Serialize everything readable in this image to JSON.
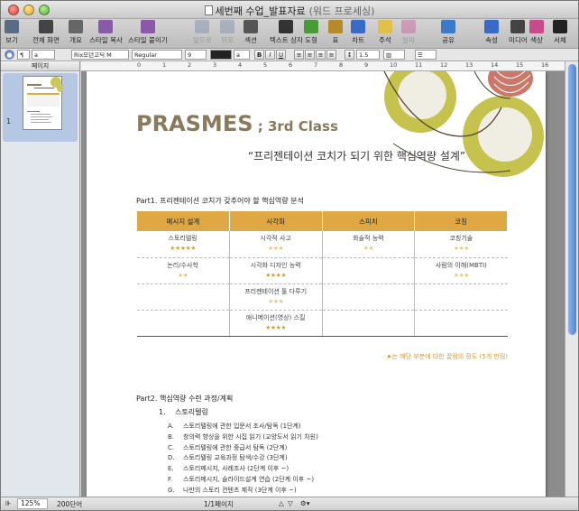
{
  "window": {
    "title": "세번째 수업_발표자료",
    "mode": "(워드 프로세싱)"
  },
  "toolbar": {
    "items": [
      {
        "label": "보기",
        "icon": "view-icon",
        "color": "#5a6b85",
        "enabled": true
      },
      {
        "label": "전체 화면",
        "icon": "fullscreen-icon",
        "color": "#444444",
        "enabled": true
      },
      {
        "label": "개요",
        "icon": "outline-icon",
        "color": "#666666",
        "enabled": true
      },
      {
        "label": "스타일 복사",
        "icon": "copy-style-icon",
        "color": "#8a5aa8",
        "enabled": true
      },
      {
        "label": "스타일 붙이기",
        "icon": "paste-style-icon",
        "color": "#8a5aa8",
        "enabled": true
      },
      {
        "label": "앞으로",
        "icon": "bring-forward-icon",
        "color": "#7c8ca8",
        "enabled": false
      },
      {
        "label": "뒤로",
        "icon": "send-backward-icon",
        "color": "#7c8ca8",
        "enabled": false
      },
      {
        "label": "섹션",
        "icon": "section-icon",
        "color": "#555555",
        "enabled": true
      },
      {
        "label": "텍스트 상자",
        "icon": "textbox-icon",
        "color": "#333333",
        "enabled": true
      },
      {
        "label": "도형",
        "icon": "shapes-icon",
        "color": "#4a9a3a",
        "enabled": true
      },
      {
        "label": "표",
        "icon": "table-icon",
        "color": "#b58a2a",
        "enabled": true
      },
      {
        "label": "차트",
        "icon": "chart-icon",
        "color": "#3a6ac8",
        "enabled": true
      },
      {
        "label": "주석",
        "icon": "comment-icon",
        "color": "#e0c04a",
        "enabled": true
      },
      {
        "label": "알파",
        "icon": "alpha-icon",
        "color": "#c85a9a",
        "enabled": false
      },
      {
        "label": "공유",
        "icon": "share-icon",
        "color": "#3a7ac8",
        "enabled": true
      },
      {
        "label": "속성",
        "icon": "inspector-icon",
        "color": "#3a6ac8",
        "enabled": true
      },
      {
        "label": "미디어",
        "icon": "media-icon",
        "color": "#444444",
        "enabled": true
      },
      {
        "label": "색상",
        "icon": "colors-icon",
        "color": "#c84a8a",
        "enabled": true
      },
      {
        "label": "서체",
        "icon": "fonts-icon",
        "color": "#222222",
        "enabled": true
      }
    ]
  },
  "format_bar": {
    "style_value": "a",
    "font_name": "Rix모던고딕 M",
    "font_style": "Regular",
    "font_size": "9",
    "char_style_value": "a",
    "bold": "B",
    "italic": "I",
    "underline": "U",
    "line_spacing": "1.5"
  },
  "sidebar": {
    "header": "페이지",
    "page_number": "1"
  },
  "ruler": {
    "numbers": [
      "0",
      "1",
      "2",
      "3",
      "4",
      "5",
      "6",
      "7",
      "8",
      "9",
      "10",
      "11",
      "12",
      "13",
      "14",
      "15",
      "16",
      "17"
    ]
  },
  "document": {
    "title_main": "PRASMES",
    "title_sep": " ; ",
    "title_sub": "3rd Class",
    "subtitle": "“프리젠테이션 코치가 되기 위한 핵심역량 설계”",
    "part1_heading": "Part1. 프리젠테이션 코치가 갖추어야 할 핵심역량 분석",
    "table": {
      "headers": [
        "메시지 설계",
        "시각화",
        "스피치",
        "코칭"
      ],
      "rows": [
        [
          {
            "text": "스토리텔링",
            "stars": "★★★★★",
            "light": false
          },
          {
            "text": "시각적 사고",
            "stars": "★★★",
            "light": true
          },
          {
            "text": "화술적 능력",
            "stars": "★★",
            "light": true
          },
          {
            "text": "코칭기술",
            "stars": "★★★",
            "light": true
          }
        ],
        [
          {
            "text": "논리/수사학",
            "stars": "★★",
            "light": true
          },
          {
            "text": "시각화 디자인 능력",
            "stars": "★★★★",
            "light": false
          },
          {
            "text": "",
            "stars": "",
            "light": false
          },
          {
            "text": "사람의 이해(MBTI)",
            "stars": "★★★",
            "light": true
          }
        ],
        [
          {
            "text": "",
            "stars": "",
            "light": false
          },
          {
            "text": "프리젠테이션 툴 다루기",
            "stars": "★★★",
            "light": true
          },
          {
            "text": "",
            "stars": "",
            "light": false
          },
          {
            "text": "",
            "stars": "",
            "light": false
          }
        ],
        [
          {
            "text": "",
            "stars": "",
            "light": false
          },
          {
            "text": "애니메이션(영상) 스킬",
            "stars": "★★★★",
            "light": false
          },
          {
            "text": "",
            "stars": "",
            "light": false
          },
          {
            "text": "",
            "stars": "",
            "light": false
          }
        ]
      ],
      "note": "★는 해당 부분에 대한 끌림의 정도 (5개 만점)"
    },
    "part2_heading": "Part2. 핵심역량 수련 과정/계획",
    "list_number": "1.",
    "list_title": "스토리텔링",
    "sub_items": [
      {
        "letter": "A.",
        "text": "스토리텔링에 관한 입문서 조사/탐독 (1단계)"
      },
      {
        "letter": "B.",
        "text": "창의력 향상을 위한 시집 읽기 (교양도서 읽기 차원)"
      },
      {
        "letter": "C.",
        "text": "스토리텔링에 관한 중급서 탐독 (2단계)"
      },
      {
        "letter": "D.",
        "text": "스토리텔링 교육과정 탐색/수강 (3단계)"
      },
      {
        "letter": "E.",
        "text": "스토리메시지, 사례조사 (2단계 이후 ~)"
      },
      {
        "letter": "F.",
        "text": "스토리메시지, 슬라이드설계 연습 (2단계 이후 ~)"
      },
      {
        "letter": "G.",
        "text": "나만의 스토리 컨텐츠 제작 (3단계 이후 ~)"
      }
    ]
  },
  "status_bar": {
    "zoom": "125%",
    "word_count": "200단어",
    "page_info": "1/1페이지"
  }
}
